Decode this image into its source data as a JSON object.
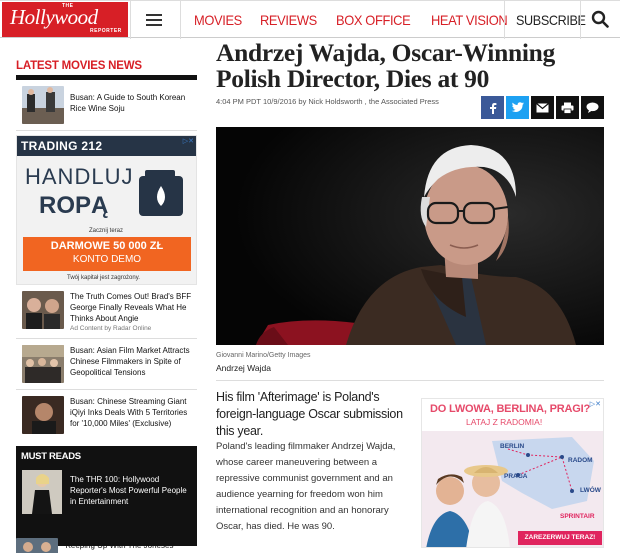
{
  "header": {
    "logo_main": "Hollywood",
    "logo_the": "THE",
    "logo_reporter": "REPORTER",
    "nav": [
      "MOVIES",
      "REVIEWS",
      "BOX OFFICE",
      "HEAT VISION"
    ],
    "subscribe": "SUBSCRIBE",
    "accent_color": "#d71f26"
  },
  "sidebar": {
    "title": "LATEST MOVIES NEWS",
    "stories": [
      {
        "text": "Busan: A Guide to South Korean Rice Wine Soju"
      }
    ],
    "ad": {
      "brand": "TRADING 212",
      "line1": "HANDLUJ",
      "line2": "ROPĄ",
      "small": "Zacznij teraz",
      "cta1": "DARMOWE 50 000 ZŁ",
      "cta2": "KONTO DEMO",
      "foot": "Twój kapitał jest zagrożony."
    },
    "stories2": [
      {
        "text": "The Truth Comes Out! Brad's BFF George Finally Reveals What He Thinks About Angie",
        "sponsor": "Ad Content by Radar Online"
      },
      {
        "text": "Busan: Asian Film Market Attracts Chinese Filmmakers in Spite of Geopolitical Tensions"
      },
      {
        "text": "Busan: Chinese Streaming Giant iQiyi Inks Deals With 5 Territories for '10,000 Miles' (Exclusive)"
      }
    ],
    "must_reads": {
      "title": "MUST READS",
      "story": "The THR 100: Hollywood Reporter's Most Powerful People in Entertainment"
    },
    "last_story": "'Keeping Up With The Joneses'"
  },
  "article": {
    "headline": "Andrzej Wajda, Oscar-Winning Polish Director, Dies at 90",
    "byline": "4:04 PM PDT 10/9/2016 by Nick Holdsworth , the Associated Press",
    "photo_credit": "Giovanni Marino/Getty Images",
    "caption": "Andrzej Wajda",
    "dek": "His film 'Afterimage' is Poland's foreign-language Oscar submission this year.",
    "body": "Poland's leading filmmaker Andrzej Wajda, whose career maneuvering between a repressive communist government and an audience yearning for freedom won him international recognition and an honorary Oscar, has died. He was 90.",
    "share_icons": [
      "facebook-icon",
      "twitter-icon",
      "email-icon",
      "print-icon",
      "comment-icon"
    ],
    "share_colors": [
      "#3b5998",
      "#1da1f2",
      "#111111",
      "#111111",
      "#111111"
    ]
  },
  "right_ad": {
    "line1": "DO LWOWA, BERLINA, PRAGI?",
    "line2": "LATAJ Z RADOMIA!",
    "cities": [
      "BERLIN",
      "PRAGA",
      "RADOM",
      "LWÓW"
    ],
    "brand": "SPRINTAIR",
    "cta": "ZAREZERWUJ TERAZ!"
  }
}
